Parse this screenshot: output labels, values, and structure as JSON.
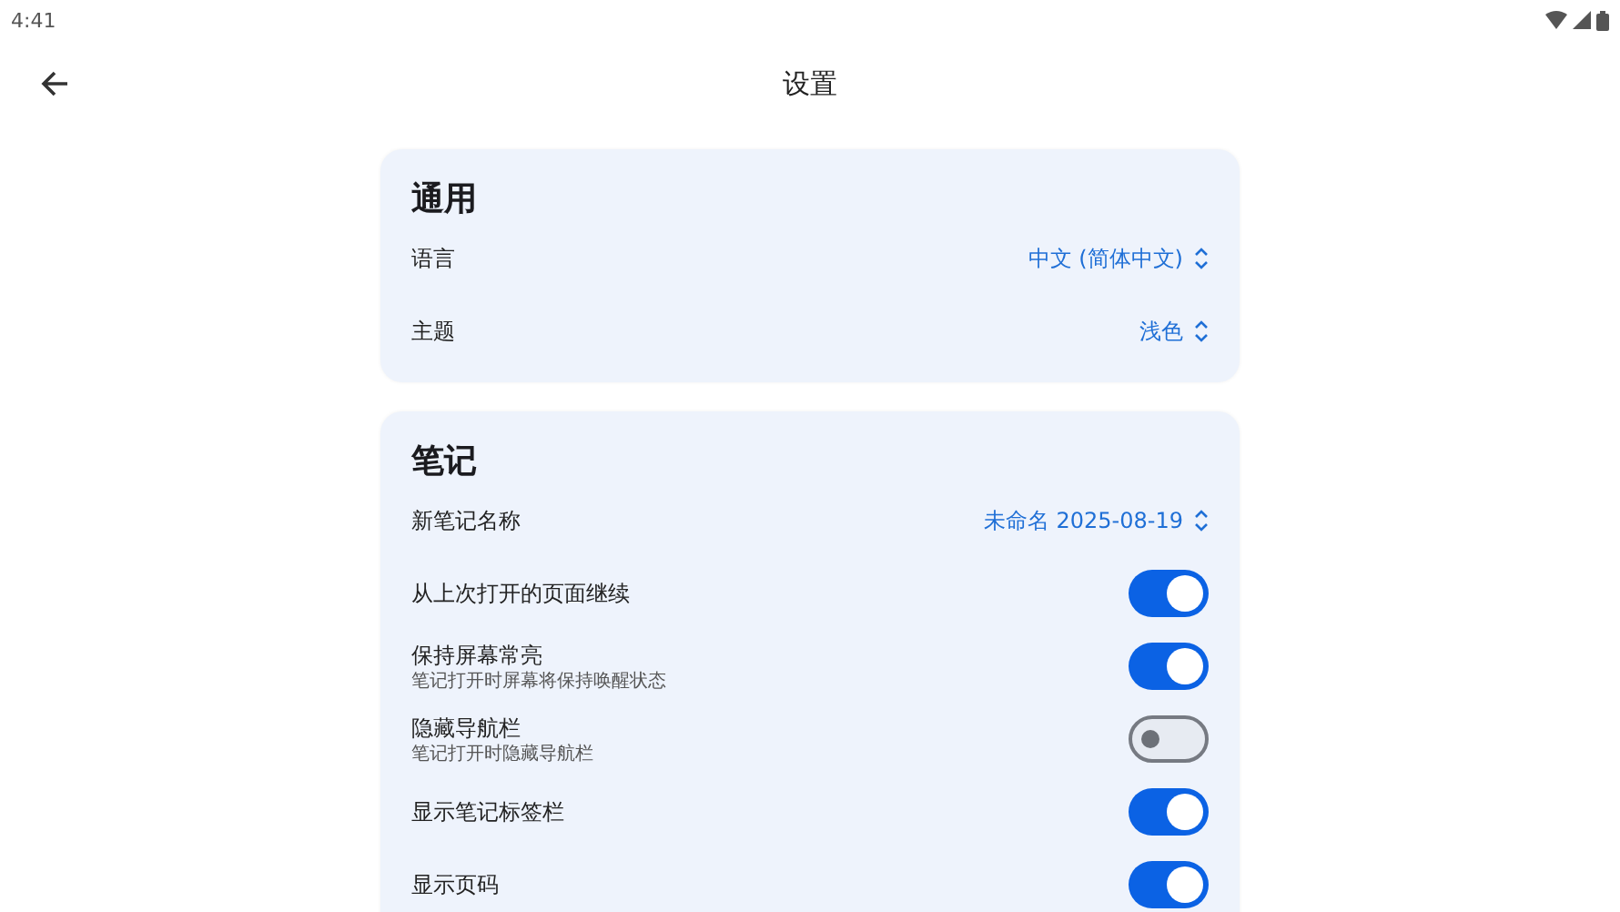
{
  "status_bar": {
    "time": "4:41"
  },
  "header": {
    "title": "设置"
  },
  "sections": [
    {
      "title": "通用",
      "rows": [
        {
          "kind": "select",
          "label": "语言",
          "value": "中文 (简体中文)"
        },
        {
          "kind": "select",
          "label": "主题",
          "value": "浅色"
        }
      ]
    },
    {
      "title": "笔记",
      "rows": [
        {
          "kind": "select",
          "label": "新笔记名称",
          "value": "未命名 2025-08-19"
        },
        {
          "kind": "toggle",
          "label": "从上次打开的页面继续",
          "on": true
        },
        {
          "kind": "toggle",
          "label": "保持屏幕常亮",
          "subtitle": "笔记打开时屏幕将保持唤醒状态",
          "on": true
        },
        {
          "kind": "toggle",
          "label": "隐藏导航栏",
          "subtitle": "笔记打开时隐藏导航栏",
          "on": false
        },
        {
          "kind": "toggle",
          "label": "显示笔记标签栏",
          "on": true
        },
        {
          "kind": "toggle",
          "label": "显示页码",
          "on": true
        }
      ]
    }
  ]
}
